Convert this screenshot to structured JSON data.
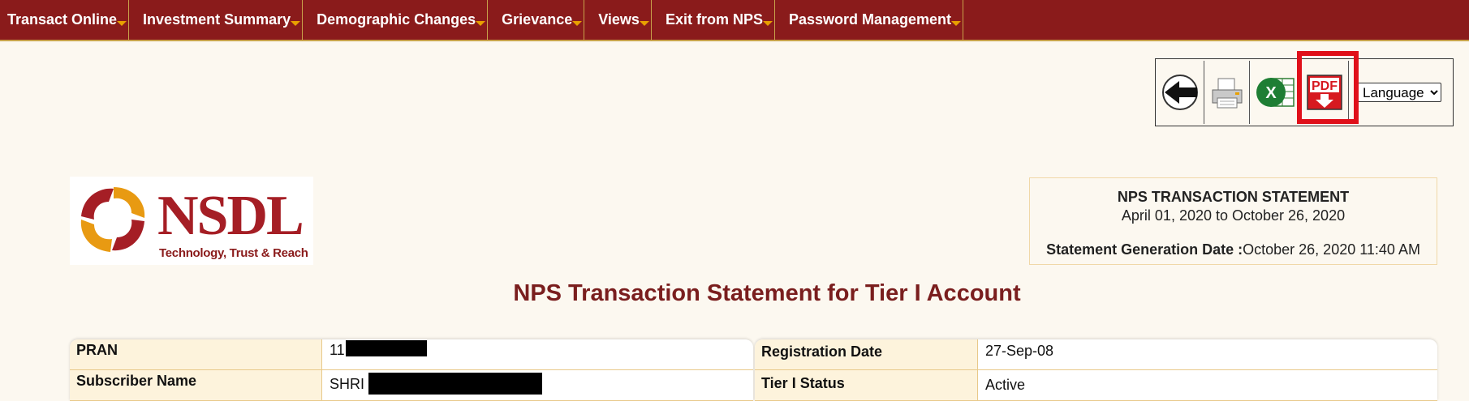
{
  "nav": {
    "items": [
      {
        "label": "Transact Online"
      },
      {
        "label": "Investment Summary"
      },
      {
        "label": "Demographic Changes"
      },
      {
        "label": "Grievance"
      },
      {
        "label": "Views"
      },
      {
        "label": "Exit from NPS"
      },
      {
        "label": "Password Management"
      }
    ]
  },
  "toolbar": {
    "language_label": "Language",
    "pdf_icon_text": "PDF",
    "excel_icon_text": "X"
  },
  "logo": {
    "name": "NSDL",
    "tagline": "Technology, Trust & Reach"
  },
  "statement": {
    "title": "NPS TRANSACTION STATEMENT",
    "range": "April 01, 2020 to October 26, 2020",
    "generation_label": "Statement Generation Date :",
    "generation_value": "October 26, 2020 11:40 AM"
  },
  "heading": "NPS Transaction Statement for Tier I Account",
  "left_table": {
    "rows": [
      {
        "label": "PRAN",
        "value": "11"
      },
      {
        "label": "Subscriber Name",
        "value": "SHRI"
      }
    ]
  },
  "right_table": {
    "rows": [
      {
        "label": "Registration Date",
        "value": "27-Sep-08"
      },
      {
        "label": "Tier I Status",
        "value": "Active"
      }
    ]
  },
  "colors": {
    "nav_bg": "#8a1b1b",
    "accent": "#c8a24a",
    "heading": "#7a1e1e",
    "highlight": "#e0101a"
  }
}
